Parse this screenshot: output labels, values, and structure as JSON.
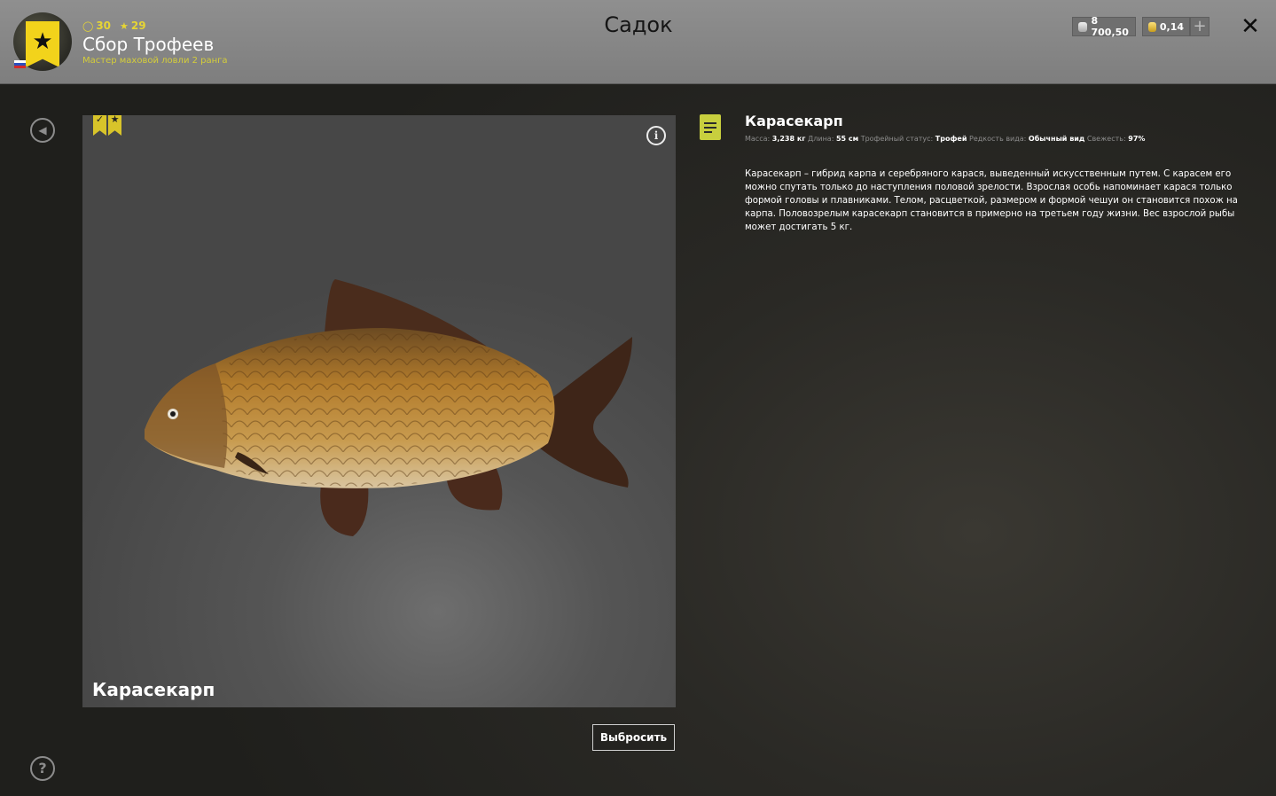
{
  "header": {
    "title": "Садок",
    "player": {
      "level": "30",
      "stars": "29",
      "name": "Сбор Трофеев",
      "rank": "Мастер маховой ловли 2 ранга"
    },
    "currency": {
      "silver": "8 700,50",
      "gold": "0,14",
      "add_label": "+"
    },
    "close_label": "✕"
  },
  "sidebar": {
    "back_icon": "back-arrow-icon",
    "help_label": "?"
  },
  "viewer": {
    "fish_name": "Карасекарп",
    "info_label": "i",
    "badge_icons": [
      "checkmark-bookmark-icon",
      "star-bookmark-icon"
    ]
  },
  "actions": {
    "release_label": "Выбросить"
  },
  "details": {
    "title": "Карасекарп",
    "stats": [
      {
        "label": "Масса:",
        "value": "3,238 кг"
      },
      {
        "label": "Длина:",
        "value": "55 см"
      },
      {
        "label": "Трофейный статус:",
        "value": "Трофей"
      },
      {
        "label": "Редкость вида:",
        "value": "Обычный вид"
      },
      {
        "label": "Свежесть:",
        "value": "97%"
      }
    ],
    "description": "Карасекарп – гибрид карпа и серебряного карася, выведенный искусственным путем. С карасем его можно спутать только до наступления половой зрелости. Взрослая особь напоминает карася только формой головы и плавниками. Телом, расцветкой, размером и формой чешуи он становится похож на карпа. Половозрелым карасекарп становится в примерно на третьем году жизни. Вес взрослой рыбы может достигать 5 кг."
  },
  "colors": {
    "accent_yellow": "#f2d31b",
    "header_bg": "#8a8a8a",
    "note_icon": "#c8cf3e"
  }
}
